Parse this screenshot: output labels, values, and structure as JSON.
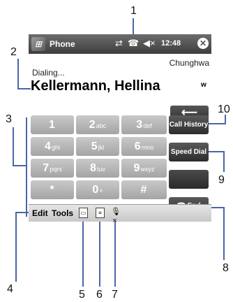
{
  "titlebar": {
    "title": "Phone",
    "time": "12:48",
    "start_icon": "windows-start-icon",
    "close_glyph": "✕"
  },
  "call": {
    "operator": "Chunghwa",
    "status": "Dialing...",
    "contact": "Kellermann, Hellina",
    "contact_type": "w"
  },
  "dialer": {
    "backspace_glyph": "⟵",
    "keys": [
      {
        "digit": "1",
        "letters": ""
      },
      {
        "digit": "2",
        "letters": "abc"
      },
      {
        "digit": "3",
        "letters": "def"
      },
      {
        "digit": "4",
        "letters": "ghi"
      },
      {
        "digit": "5",
        "letters": "jkl"
      },
      {
        "digit": "6",
        "letters": "mno"
      },
      {
        "digit": "7",
        "letters": "pqrs"
      },
      {
        "digit": "8",
        "letters": "tuv"
      },
      {
        "digit": "9",
        "letters": "wxyz"
      },
      {
        "digit": "*",
        "letters": ""
      },
      {
        "digit": "0",
        "letters": "+"
      },
      {
        "digit": "#",
        "letters": ""
      }
    ],
    "call_history": "Call History",
    "speed_dial": "Speed Dial",
    "end": "End"
  },
  "menubar": {
    "edit": "Edit",
    "tools": "Tools"
  },
  "callouts": [
    "1",
    "2",
    "3",
    "4",
    "5",
    "6",
    "7",
    "8",
    "9",
    "10"
  ],
  "colors": {
    "titlebar": "#4a4a4a",
    "keypad": "#b8b8b8",
    "function_key": "#3a3a3a",
    "callout_line": "#4a66a8"
  }
}
